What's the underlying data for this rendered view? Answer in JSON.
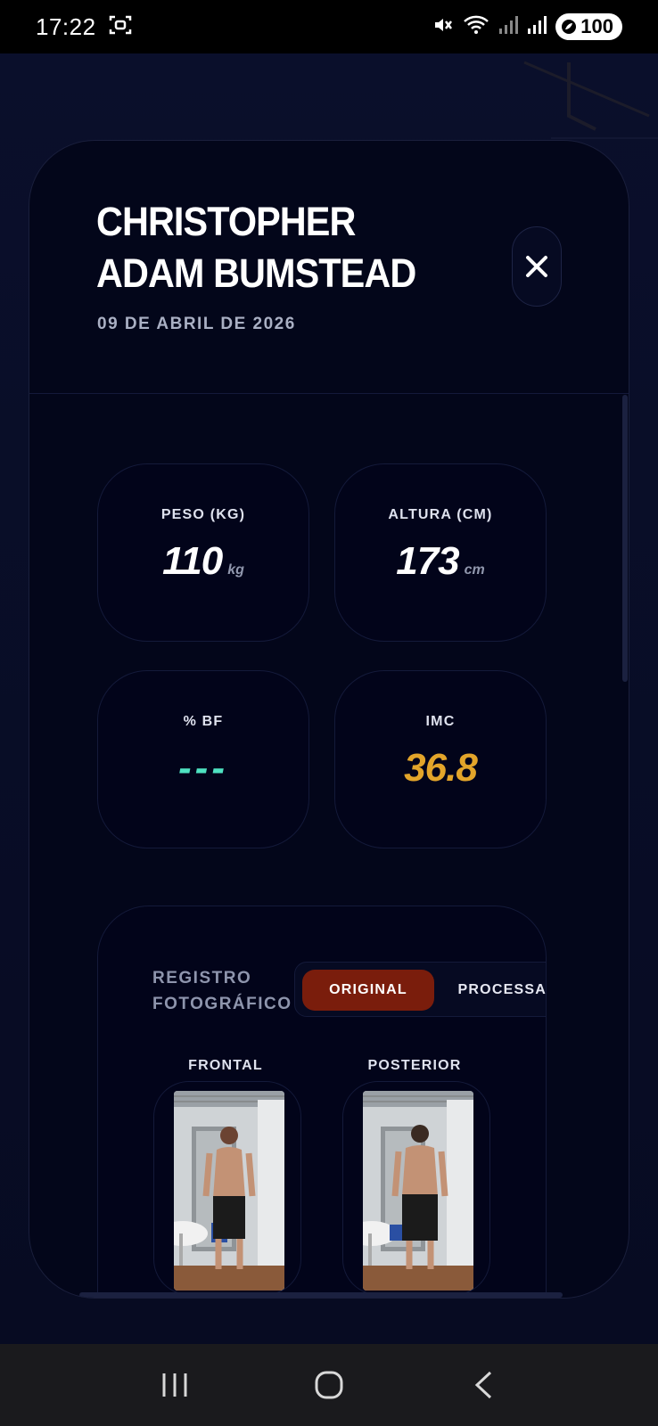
{
  "status_bar": {
    "time": "17:22",
    "battery": "100"
  },
  "athlete": {
    "name": "CHRISTOPHER ADAM BUMSTEAD",
    "date": "09 DE ABRIL DE 2026"
  },
  "metrics": {
    "peso": {
      "label": "PESO (KG)",
      "value": "110",
      "unit": "kg"
    },
    "altura": {
      "label": "ALTURA (CM)",
      "value": "173",
      "unit": "cm"
    },
    "bf": {
      "label": "% BF",
      "value": "---"
    },
    "imc": {
      "label": "IMC",
      "value": "36.8"
    }
  },
  "photos": {
    "title": "REGISTRO FOTOGRÁFICO",
    "toggle": {
      "original": "ORIGINAL",
      "processada": "PROCESSADA",
      "selected": "ORIGINAL"
    },
    "frontal_label": "FRONTAL",
    "posterior_label": "POSTERIOR"
  },
  "colors": {
    "accent_active": "#7a1d0c",
    "bf_color": "#4fe2c1",
    "imc_color": "#e3a52a",
    "background": "#03061a"
  },
  "icons": {
    "close": "close-icon",
    "nav_recents": "recents-icon",
    "nav_home": "home-icon",
    "nav_back": "back-icon"
  }
}
